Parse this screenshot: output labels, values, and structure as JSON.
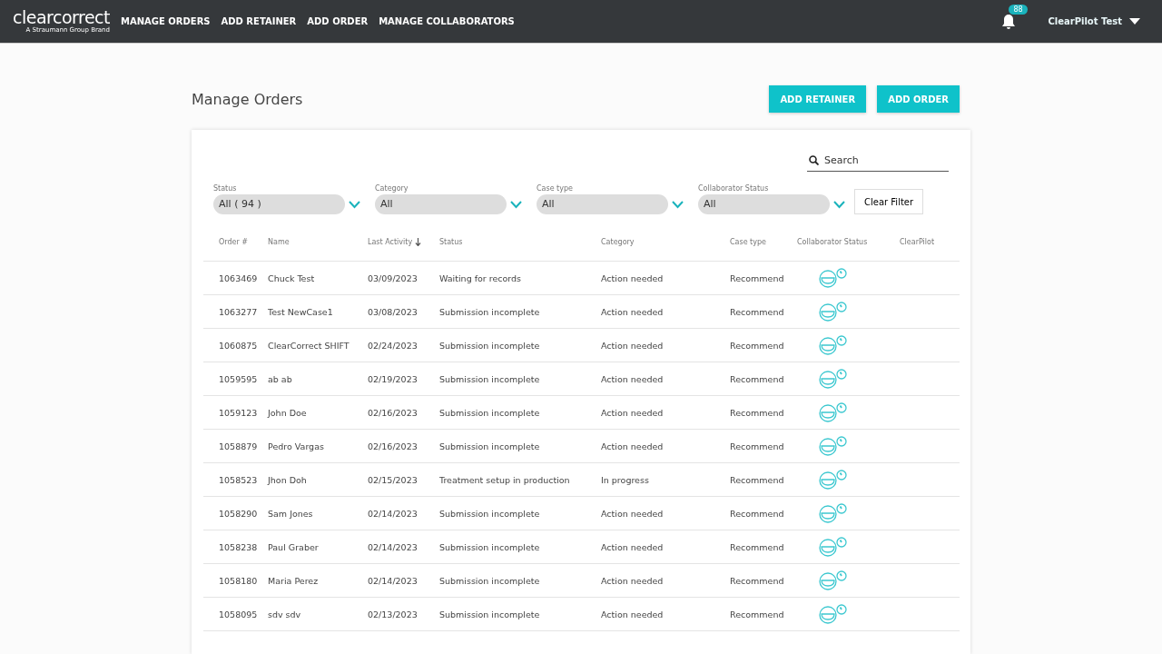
{
  "header": {
    "logo": "clearcorrect",
    "logo_tagline": "A Straumann Group Brand",
    "nav": [
      "MANAGE ORDERS",
      "ADD RETAINER",
      "ADD ORDER",
      "MANAGE COLLABORATORS"
    ],
    "notification_count": "88",
    "user": "ClearPilot Test"
  },
  "page": {
    "title": "Manage Orders",
    "buttons": [
      "ADD RETAINER",
      "ADD ORDER"
    ]
  },
  "search": {
    "placeholder": "Search"
  },
  "filters": [
    {
      "label": "Status",
      "value": "All ( 94 )"
    },
    {
      "label": "Category",
      "value": "All"
    },
    {
      "label": "Case type",
      "value": "All"
    },
    {
      "label": "Collaborator Status",
      "value": "All"
    }
  ],
  "clear_filter": "Clear Filter",
  "table": {
    "columns": [
      "Order #",
      "Name",
      "Last Activity",
      "Status",
      "Category",
      "Case type",
      "Collaborator Status",
      "ClearPilot"
    ],
    "rows": [
      [
        "1063469",
        "Chuck Test",
        "03/09/2023",
        "Waiting for records",
        "Action needed",
        "Recommend"
      ],
      [
        "1063277",
        "Test NewCase1",
        "03/08/2023",
        "Submission incomplete",
        "Action needed",
        "Recommend"
      ],
      [
        "1060875",
        "ClearCorrect SHIFT",
        "02/24/2023",
        "Submission incomplete",
        "Action needed",
        "Recommend"
      ],
      [
        "1059595",
        "ab ab",
        "02/19/2023",
        "Submission incomplete",
        "Action needed",
        "Recommend"
      ],
      [
        "1059123",
        "John Doe",
        "02/16/2023",
        "Submission incomplete",
        "Action needed",
        "Recommend"
      ],
      [
        "1058879",
        "Pedro Vargas",
        "02/16/2023",
        "Submission incomplete",
        "Action needed",
        "Recommend"
      ],
      [
        "1058523",
        "Jhon Doh",
        "02/15/2023",
        "Treatment setup in production",
        "In progress",
        "Recommend"
      ],
      [
        "1058290",
        "Sam Jones",
        "02/14/2023",
        "Submission incomplete",
        "Action needed",
        "Recommend"
      ],
      [
        "1058238",
        "Paul Graber",
        "02/14/2023",
        "Submission incomplete",
        "Action needed",
        "Recommend"
      ],
      [
        "1058180",
        "Maria Perez",
        "02/14/2023",
        "Submission incomplete",
        "Action needed",
        "Recommend"
      ],
      [
        "1058095",
        "sdv sdv",
        "02/13/2023",
        "Submission incomplete",
        "Action needed",
        "Recommend"
      ]
    ]
  }
}
